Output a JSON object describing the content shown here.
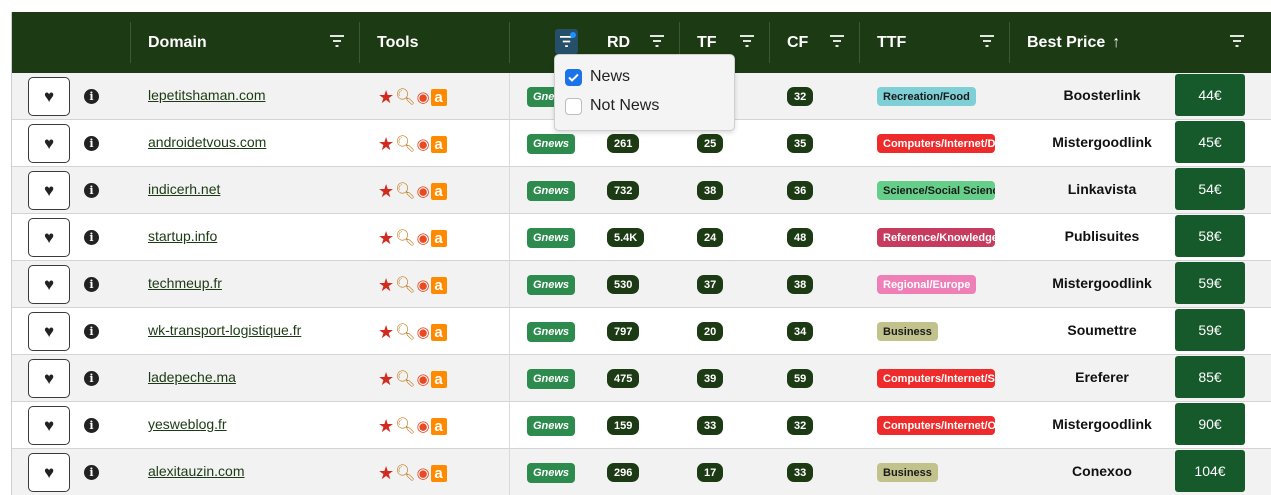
{
  "header": {
    "domain_label": "Domain",
    "tools_label": "Tools",
    "rd_label": "RD",
    "tf_label": "TF",
    "cf_label": "CF",
    "ttf_label": "TTF",
    "best_price_label": "Best Price",
    "sort_indicator": "↑"
  },
  "filter_menu": {
    "options": [
      {
        "label": "News",
        "checked": true
      },
      {
        "label": "Not News",
        "checked": false
      }
    ]
  },
  "tools_icons": [
    "star-icon",
    "magnifier-icon",
    "ring-icon",
    "a-logo-icon"
  ],
  "gnews_label": "Gnews",
  "rows": [
    {
      "domain": "lepetitshaman.com",
      "rd": "",
      "tf": "",
      "cf": "32",
      "ttf": "Recreation/Food",
      "ttf_bg": "#7fcfd6",
      "ttf_fg": "#1a1a1a",
      "seller": "Boosterlink",
      "price": "44€"
    },
    {
      "domain": "androidetvous.com",
      "rd": "261",
      "tf": "25",
      "cf": "35",
      "ttf": "Computers/Internet/D",
      "ttf_bg": "#ee2a2a",
      "ttf_fg": "#ffffff",
      "seller": "Mistergoodlink",
      "price": "45€"
    },
    {
      "domain": "indicerh.net",
      "rd": "732",
      "tf": "38",
      "cf": "36",
      "ttf": "Science/Social Science",
      "ttf_bg": "#65cf8a",
      "ttf_fg": "#1a1a1a",
      "seller": "Linkavista",
      "price": "54€"
    },
    {
      "domain": "startup.info",
      "rd": "5.4K",
      "tf": "24",
      "cf": "48",
      "ttf": "Reference/Knowledge",
      "ttf_bg": "#c73b5f",
      "ttf_fg": "#ffffff",
      "seller": "Publisuites",
      "price": "58€"
    },
    {
      "domain": "techmeup.fr",
      "rd": "530",
      "tf": "37",
      "cf": "38",
      "ttf": "Regional/Europe",
      "ttf_bg": "#ee7fb7",
      "ttf_fg": "#ffffff",
      "seller": "Mistergoodlink",
      "price": "59€"
    },
    {
      "domain": "wk-transport-logistique.fr",
      "rd": "797",
      "tf": "20",
      "cf": "34",
      "ttf": "Business",
      "ttf_bg": "#c2c28d",
      "ttf_fg": "#1a1a1a",
      "seller": "Soumettre",
      "price": "59€"
    },
    {
      "domain": "ladepeche.ma",
      "rd": "475",
      "tf": "39",
      "cf": "59",
      "ttf": "Computers/Internet/S",
      "ttf_bg": "#ee2a2a",
      "ttf_fg": "#ffffff",
      "seller": "Ereferer",
      "price": "85€"
    },
    {
      "domain": "yesweblog.fr",
      "rd": "159",
      "tf": "33",
      "cf": "32",
      "ttf": "Computers/Internet/O",
      "ttf_bg": "#ee2a2a",
      "ttf_fg": "#ffffff",
      "seller": "Mistergoodlink",
      "price": "90€"
    },
    {
      "domain": "alexitauzin.com",
      "rd": "296",
      "tf": "17",
      "cf": "33",
      "ttf": "Business",
      "ttf_bg": "#c2c28d",
      "ttf_fg": "#1a1a1a",
      "seller": "Conexoo",
      "price": "104€"
    }
  ]
}
